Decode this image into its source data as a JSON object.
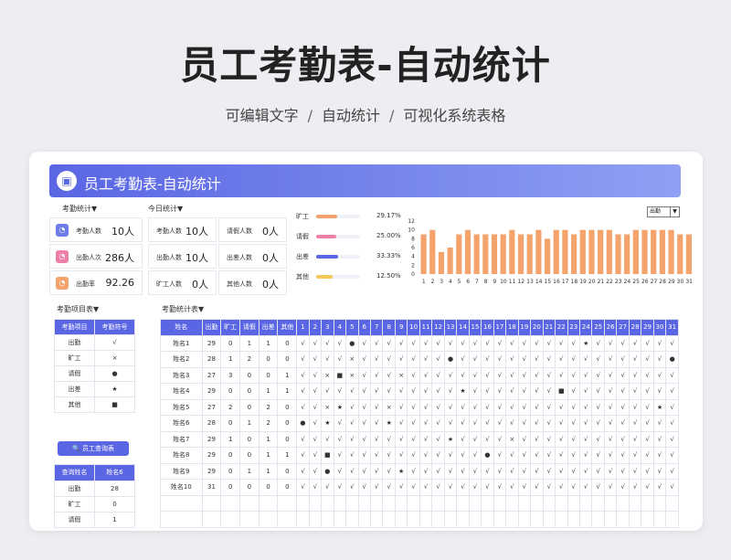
{
  "headline": "员工考勤表-自动统计",
  "subtitle": {
    "p1": "可编辑文字",
    "p2": "自动统计",
    "p3": "可视化系统表格",
    "sep": "/"
  },
  "app": {
    "title": "员工考勤表-自动统计"
  },
  "sections": {
    "attendance_stats": "考勤统计▼",
    "today_stats": "今日统计▼",
    "legend_title": "考勤项目表▼",
    "main_table": "考勤统计表▼"
  },
  "attendance_metrics": [
    {
      "label": "考勤人数",
      "value": "10人",
      "icon": "clock-icon",
      "color": "#6f7be8"
    },
    {
      "label": "出勤人次",
      "value": "286人",
      "icon": "clock-icon",
      "color": "#ee7fa8"
    },
    {
      "label": "出勤率",
      "value": "92.26",
      "icon": "clock-icon",
      "color": "#f3a36b"
    }
  ],
  "today_metrics": [
    {
      "label": "考勤人数",
      "value": "10人"
    },
    {
      "label": "请假人数",
      "value": "0人"
    },
    {
      "label": "出勤人数",
      "value": "10人"
    },
    {
      "label": "出差人数",
      "value": "0人"
    },
    {
      "label": "旷工人数",
      "value": "0人"
    },
    {
      "label": "其他人数",
      "value": "0人"
    }
  ],
  "ratio_bars": [
    {
      "label": "旷工",
      "pct": "29.17%",
      "fraction": 0.29,
      "color": "#f3a36b"
    },
    {
      "label": "请假",
      "pct": "25.00%",
      "fraction": 0.25,
      "color": "#ee7fa8"
    },
    {
      "label": "出差",
      "pct": "33.33%",
      "fraction": 0.33,
      "color": "#5a66e3"
    },
    {
      "label": "其他",
      "pct": "12.50%",
      "fraction": 0.125,
      "color": "#f5c85a"
    }
  ],
  "dropdown": {
    "value": "出勤",
    "arrow": "▼"
  },
  "chart_data": {
    "type": "bar",
    "categories": [
      "1",
      "2",
      "3",
      "4",
      "5",
      "6",
      "7",
      "8",
      "9",
      "10",
      "11",
      "12",
      "13",
      "14",
      "15",
      "16",
      "17",
      "18",
      "19",
      "20",
      "21",
      "22",
      "23",
      "24",
      "25",
      "26",
      "27",
      "28",
      "29",
      "30",
      "31"
    ],
    "values": [
      9,
      10,
      5,
      6,
      9,
      10,
      9,
      9,
      9,
      9,
      10,
      9,
      9,
      10,
      8,
      10,
      10,
      9,
      10,
      10,
      10,
      10,
      9,
      9,
      10,
      10,
      10,
      10,
      10,
      9,
      9
    ],
    "ylim": [
      0,
      12
    ],
    "yticks": [
      "12",
      "10",
      "8",
      "6",
      "4",
      "2",
      "0"
    ],
    "color": "#f3a36b"
  },
  "legend_table": {
    "headers": [
      "考勤项目",
      "考勤符号"
    ],
    "rows": [
      [
        "出勤",
        "√"
      ],
      [
        "旷工",
        "×"
      ],
      [
        "请假",
        "●"
      ],
      [
        "出差",
        "★"
      ],
      [
        "其他",
        "■"
      ]
    ]
  },
  "query": {
    "button": "员工查询表",
    "icon": "search-icon",
    "headers": [
      "查询姓名",
      "姓名6"
    ],
    "rows": [
      [
        "出勤",
        "28"
      ],
      [
        "旷工",
        "0"
      ],
      [
        "请假",
        "1"
      ]
    ]
  },
  "main_table": {
    "headers": [
      "姓名",
      "出勤",
      "旷工",
      "请假",
      "出差",
      "其他",
      "1",
      "2",
      "3",
      "4",
      "5",
      "6",
      "7",
      "8",
      "9",
      "10",
      "11",
      "12",
      "13",
      "14",
      "15",
      "16",
      "17",
      "18",
      "19",
      "20",
      "21",
      "22",
      "23",
      "24",
      "25",
      "26",
      "27",
      "28",
      "29",
      "30",
      "31"
    ],
    "rows": [
      [
        "姓名1",
        "29",
        "0",
        "1",
        "1",
        "0",
        "√",
        "√",
        "√",
        "√",
        "●",
        "√",
        "√",
        "√",
        "√",
        "√",
        "√",
        "√",
        "√",
        "√",
        "√",
        "√",
        "√",
        "√",
        "√",
        "√",
        "√",
        "√",
        "√",
        "★",
        "√",
        "√",
        "√",
        "√",
        "√",
        "√",
        "√"
      ],
      [
        "姓名2",
        "28",
        "1",
        "2",
        "0",
        "0",
        "√",
        "√",
        "√",
        "√",
        "×",
        "√",
        "√",
        "√",
        "√",
        "√",
        "√",
        "√",
        "●",
        "√",
        "√",
        "√",
        "√",
        "√",
        "√",
        "√",
        "√",
        "√",
        "√",
        "√",
        "√",
        "√",
        "√",
        "√",
        "√",
        "√",
        "●"
      ],
      [
        "姓名3",
        "27",
        "3",
        "0",
        "0",
        "1",
        "√",
        "√",
        "×",
        "■",
        "×",
        "√",
        "√",
        "√",
        "×",
        "√",
        "√",
        "√",
        "√",
        "√",
        "√",
        "√",
        "√",
        "√",
        "√",
        "√",
        "√",
        "√",
        "√",
        "√",
        "√",
        "√",
        "√",
        "√",
        "√",
        "√",
        "√"
      ],
      [
        "姓名4",
        "29",
        "0",
        "0",
        "1",
        "1",
        "√",
        "√",
        "√",
        "√",
        "√",
        "√",
        "√",
        "√",
        "√",
        "√",
        "√",
        "√",
        "√",
        "★",
        "√",
        "√",
        "√",
        "√",
        "√",
        "√",
        "√",
        "■",
        "√",
        "√",
        "√",
        "√",
        "√",
        "√",
        "√",
        "√",
        "√"
      ],
      [
        "姓名5",
        "27",
        "2",
        "0",
        "2",
        "0",
        "√",
        "√",
        "×",
        "★",
        "√",
        "√",
        "√",
        "×",
        "√",
        "√",
        "√",
        "√",
        "√",
        "√",
        "√",
        "√",
        "√",
        "√",
        "√",
        "√",
        "√",
        "√",
        "√",
        "√",
        "√",
        "√",
        "√",
        "√",
        "√",
        "★",
        "√"
      ],
      [
        "姓名6",
        "28",
        "0",
        "1",
        "2",
        "0",
        "●",
        "√",
        "★",
        "√",
        "√",
        "√",
        "√",
        "★",
        "√",
        "√",
        "√",
        "√",
        "√",
        "√",
        "√",
        "√",
        "√",
        "√",
        "√",
        "√",
        "√",
        "√",
        "√",
        "√",
        "√",
        "√",
        "√",
        "√",
        "√",
        "√",
        "√"
      ],
      [
        "姓名7",
        "29",
        "1",
        "0",
        "1",
        "0",
        "√",
        "√",
        "√",
        "√",
        "√",
        "√",
        "√",
        "√",
        "√",
        "√",
        "√",
        "√",
        "★",
        "√",
        "√",
        "√",
        "√",
        "×",
        "√",
        "√",
        "√",
        "√",
        "√",
        "√",
        "√",
        "√",
        "√",
        "√",
        "√",
        "√",
        "√"
      ],
      [
        "姓名8",
        "29",
        "0",
        "0",
        "1",
        "1",
        "√",
        "√",
        "■",
        "√",
        "√",
        "√",
        "√",
        "√",
        "√",
        "√",
        "√",
        "√",
        "√",
        "√",
        "√",
        "●",
        "√",
        "√",
        "√",
        "√",
        "√",
        "√",
        "√",
        "√",
        "√",
        "√",
        "√",
        "√",
        "√",
        "√",
        "√"
      ],
      [
        "姓名9",
        "29",
        "0",
        "1",
        "1",
        "0",
        "√",
        "√",
        "●",
        "√",
        "√",
        "√",
        "√",
        "√",
        "★",
        "√",
        "√",
        "√",
        "√",
        "√",
        "√",
        "√",
        "√",
        "√",
        "√",
        "√",
        "√",
        "√",
        "√",
        "√",
        "√",
        "√",
        "√",
        "√",
        "√",
        "√",
        "√"
      ],
      [
        "姓名10",
        "31",
        "0",
        "0",
        "0",
        "0",
        "√",
        "√",
        "√",
        "√",
        "√",
        "√",
        "√",
        "√",
        "√",
        "√",
        "√",
        "√",
        "√",
        "√",
        "√",
        "√",
        "√",
        "√",
        "√",
        "√",
        "√",
        "√",
        "√",
        "√",
        "√",
        "√",
        "√",
        "√",
        "√",
        "√",
        "√"
      ],
      [
        "",
        "",
        "",
        "",
        "",
        "",
        "",
        "",
        "",
        "",
        "",
        "",
        "",
        "",
        "",
        "",
        "",
        "",
        "",
        "",
        "",
        "",
        "",
        "",
        "",
        "",
        "",
        "",
        "",
        "",
        "",
        "",
        "",
        "",
        "",
        "",
        ""
      ],
      [
        "",
        "",
        "",
        "",
        "",
        "",
        "",
        "",
        "",
        "",
        "",
        "",
        "",
        "",
        "",
        "",
        "",
        "",
        "",
        "",
        "",
        "",
        "",
        "",
        "",
        "",
        "",
        "",
        "",
        "",
        "",
        "",
        "",
        "",
        "",
        "",
        ""
      ]
    ]
  }
}
